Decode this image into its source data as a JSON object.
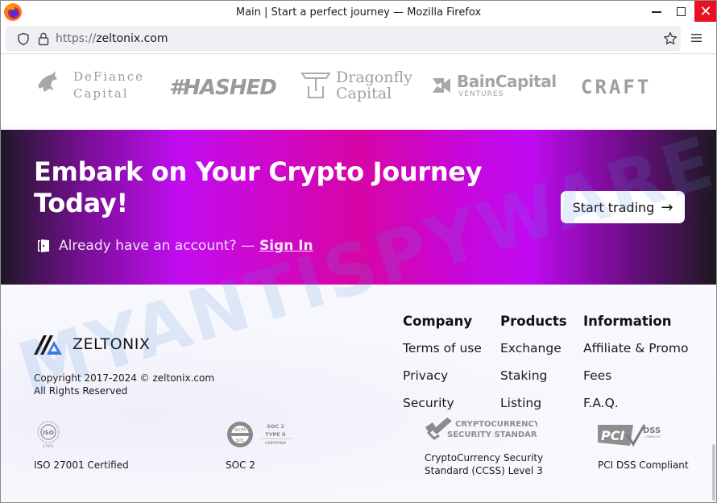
{
  "window": {
    "title": "Main | Start a perfect journey — Mozilla Firefox",
    "controls": {
      "minimize": "minimize",
      "maximize": "maximize",
      "close": "✕"
    }
  },
  "navbar": {
    "url_protocol": "https://",
    "url_host": "zeltonix.com"
  },
  "partners": [
    {
      "name": "DeFiance",
      "sub": "Capital"
    },
    {
      "name": "#HASHED"
    },
    {
      "name": "Dragonfly",
      "sub": "Capital"
    },
    {
      "name": "BainCapital",
      "sub": "VENTURES"
    },
    {
      "name": "CRAFT"
    }
  ],
  "cta": {
    "title": "Embark on Your Crypto Journey Today!",
    "account_prompt": "Already have an account? —",
    "sign_in": "Sign In",
    "start_button": "Start trading",
    "start_arrow": "→"
  },
  "footer": {
    "brand": "ZELTONIX",
    "copyright_line1": "Copyright 2017-2024 © zeltonix.com",
    "copyright_line2": "All Rights Reserved",
    "columns": [
      {
        "heading": "Company",
        "links": [
          "Terms of use",
          "Privacy",
          "Security"
        ]
      },
      {
        "heading": "Products",
        "links": [
          "Exchange",
          "Staking",
          "Listing"
        ]
      },
      {
        "heading": "Information",
        "links": [
          "Affiliate & Promo",
          "Fees",
          "F.A.Q."
        ]
      }
    ],
    "certifications": [
      {
        "badge": "ISO 27001",
        "label": "ISO 27001 Certified"
      },
      {
        "badge": "SOC 2 TYPE II CERTIFIED",
        "label": "SOC 2"
      },
      {
        "badge": "CRYPTOCURRENCY SECURITY STANDARD",
        "label_line1": "CryptoCurrency Security",
        "label_line2": "Standard (CCSS) Level 3"
      },
      {
        "badge": "PCI DSS COMPLIANT",
        "label": "PCI DSS Compliant"
      }
    ]
  },
  "watermark": "MYANTISPYWARE.COM",
  "colors": {
    "cta_purple": "#c10df0",
    "cta_magenta": "#d705a5",
    "brand_blue": "#3a7be0",
    "close_red": "#e81123"
  }
}
